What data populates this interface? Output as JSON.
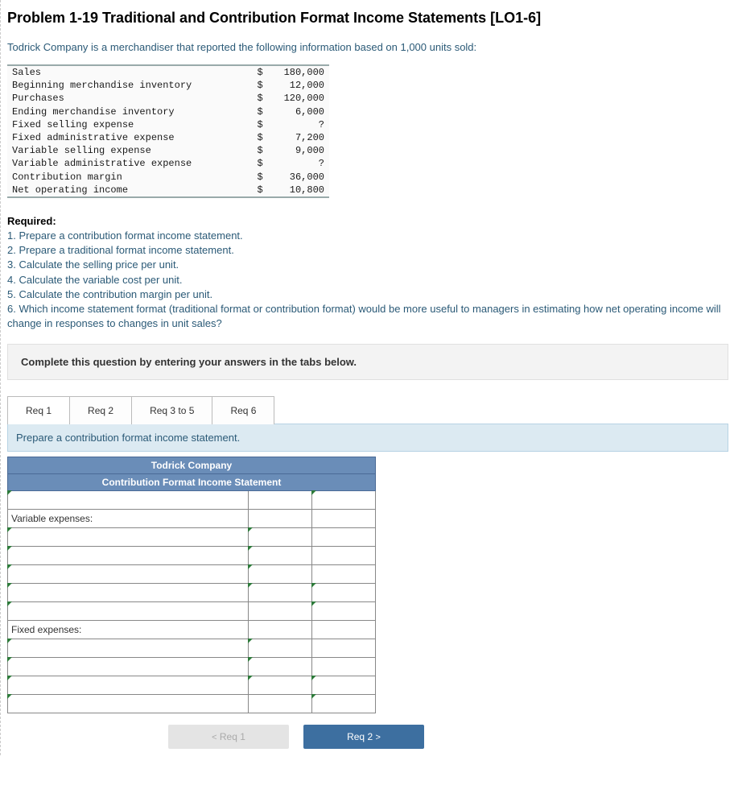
{
  "title": "Problem 1-19 Traditional and Contribution Format Income Statements [LO1-6]",
  "intro": "Todrick Company is a merchandiser that reported the following information based on 1,000 units sold:",
  "given": [
    {
      "label": "Sales",
      "sym": "$",
      "value": "180,000"
    },
    {
      "label": "Beginning merchandise inventory",
      "sym": "$",
      "value": "12,000"
    },
    {
      "label": "Purchases",
      "sym": "$",
      "value": "120,000"
    },
    {
      "label": "Ending merchandise inventory",
      "sym": "$",
      "value": "6,000"
    },
    {
      "label": "Fixed selling expense",
      "sym": "$",
      "value": "?"
    },
    {
      "label": "Fixed administrative expense",
      "sym": "$",
      "value": "7,200"
    },
    {
      "label": "Variable selling expense",
      "sym": "$",
      "value": "9,000"
    },
    {
      "label": "Variable administrative expense",
      "sym": "$",
      "value": "?"
    },
    {
      "label": "Contribution margin",
      "sym": "$",
      "value": "36,000"
    },
    {
      "label": "Net operating income",
      "sym": "$",
      "value": "10,800"
    }
  ],
  "required_head": "Required:",
  "required": [
    "1. Prepare a contribution format income statement.",
    "2. Prepare a traditional format income statement.",
    "3. Calculate the selling price per unit.",
    "4. Calculate the variable cost per unit.",
    "5. Calculate the contribution margin per unit.",
    "6. Which income statement format (traditional format or contribution format) would be more useful to managers in estimating how net operating income will change in responses to changes in unit sales?"
  ],
  "instruction": "Complete this question by entering your answers in the tabs below.",
  "tabs": [
    "Req 1",
    "Req 2",
    "Req 3 to 5",
    "Req 6"
  ],
  "tab_prompt": "Prepare a contribution format income statement.",
  "answer_header1": "Todrick Company",
  "answer_header2": "Contribution Format Income Statement",
  "row_labels": {
    "variable": "Variable expenses:",
    "fixed": "Fixed expenses:"
  },
  "nav": {
    "prev": "Req 1",
    "next": "Req 2"
  }
}
